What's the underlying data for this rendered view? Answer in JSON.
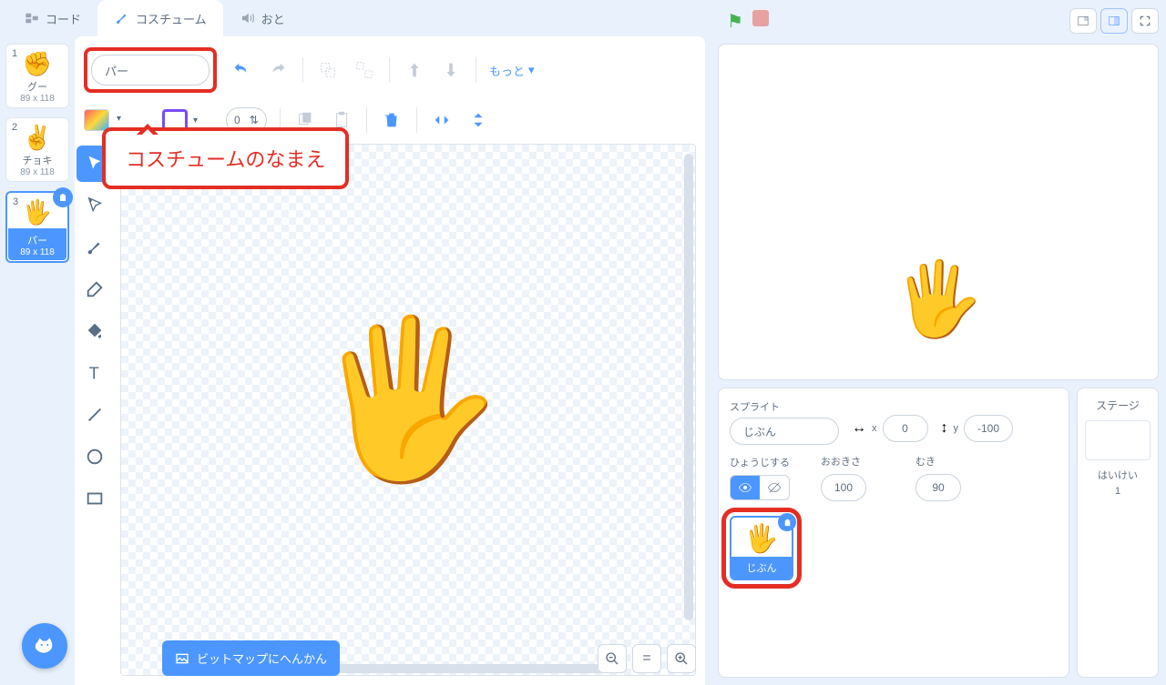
{
  "tabs": {
    "code": "コード",
    "costumes": "コスチューム",
    "sounds": "おと"
  },
  "costumes": [
    {
      "num": "1",
      "emoji": "✊",
      "name": "グー",
      "size": "89 x 118"
    },
    {
      "num": "2",
      "emoji": "✌️",
      "name": "チョキ",
      "size": "89 x 118"
    },
    {
      "num": "3",
      "emoji": "🖐️",
      "name": "パー",
      "size": "89 x 118"
    }
  ],
  "costumeNameValue": "パー",
  "callout": "コスチュームのなまえ",
  "more": "もっと",
  "strokeWidth": "0",
  "bitmapBtn": "ビットマップにへんかん",
  "sprite": {
    "label": "スプライト",
    "name": "じぶん",
    "xLabel": "x",
    "x": "0",
    "yLabel": "y",
    "y": "-100",
    "showLabel": "ひょうじする",
    "sizeLabel": "おおきさ",
    "size": "100",
    "dirLabel": "むき",
    "dir": "90"
  },
  "spriteItem": {
    "emoji": "🖐️",
    "name": "じぶん"
  },
  "stagePanel": {
    "title": "ステージ",
    "backdrop": "はいけい",
    "count": "1"
  },
  "canvasEmoji": "🖐️",
  "stageEmoji": "🖐️"
}
